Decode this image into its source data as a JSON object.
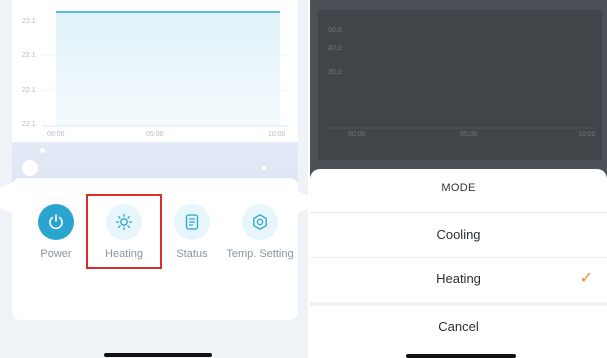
{
  "chart": {
    "y_ticks": [
      "22.1",
      "22.1",
      "22.1",
      "22.1"
    ],
    "x_ticks": [
      "00:00",
      "05:00",
      "10:00"
    ],
    "line_color": "#2aa5cf"
  },
  "controls": [
    {
      "label": "Power",
      "icon": "power-icon",
      "selected": false
    },
    {
      "label": "Heating",
      "icon": "sun-icon",
      "selected": true
    },
    {
      "label": "Status",
      "icon": "document-icon",
      "selected": false
    },
    {
      "label": "Temp. Setting",
      "icon": "gear-icon",
      "selected": false
    }
  ],
  "dimmed_chart": {
    "y_ticks": [
      "50.0",
      "40.0",
      "30.0"
    ],
    "x_ticks": [
      "00:00",
      "05:00",
      "10:00"
    ]
  },
  "mode_sheet": {
    "title": "MODE",
    "options": [
      "Cooling",
      "Heating"
    ],
    "selected": "Heating",
    "cancel": "Cancel",
    "check_color": "#f08a2b"
  },
  "colors": {
    "accent": "#2aa5cf",
    "highlight_border": "#e02b2b"
  }
}
